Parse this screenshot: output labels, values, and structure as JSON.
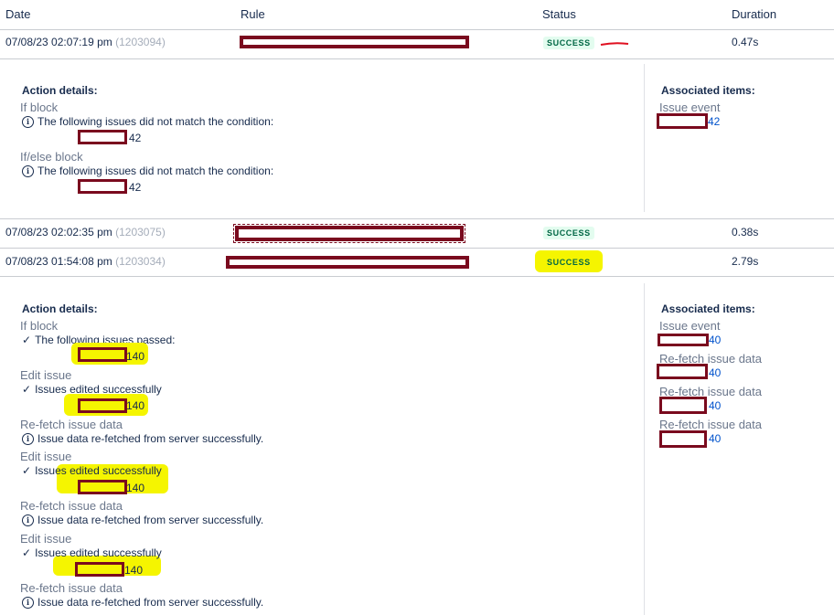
{
  "table": {
    "headers": {
      "date": "Date",
      "rule": "Rule",
      "status": "Status",
      "duration": "Duration"
    },
    "rows": [
      {
        "date": "07/08/23 02:07:19 pm",
        "id": "(1203094)",
        "status": "SUCCESS",
        "duration": "0.47s"
      },
      {
        "date": "07/08/23 02:02:35 pm",
        "id": "(1203075)",
        "status": "SUCCESS",
        "duration": "0.38s"
      },
      {
        "date": "07/08/23 01:54:08 pm",
        "id": "(1203034)",
        "status": "SUCCESS",
        "duration": "2.79s"
      }
    ]
  },
  "detail1": {
    "title": "Action details:",
    "blocks": [
      {
        "type": "If block",
        "icon": "info-icon",
        "message": "The following issues did not match the condition:",
        "num": "42"
      },
      {
        "type": "If/else block",
        "icon": "info-icon",
        "message": "The following issues did not match the condition:",
        "num": "42"
      }
    ],
    "assoc_title": "Associated items:",
    "assoc": [
      {
        "label": "Issue event",
        "num": "42"
      }
    ]
  },
  "detail2": {
    "title": "Action details:",
    "blocks": [
      {
        "type": "If block",
        "icon": "check-icon",
        "message": "The following issues passed:",
        "num": "140"
      },
      {
        "type": "Edit issue",
        "icon": "check-icon",
        "message": "Issues edited successfully",
        "num": "140"
      },
      {
        "type": "Re-fetch issue data",
        "icon": "info-icon",
        "message": "Issue data re-fetched from server successfully.",
        "num": ""
      },
      {
        "type": "Edit issue",
        "icon": "check-icon",
        "message": "Issues edited successfully",
        "num": "140"
      },
      {
        "type": "Re-fetch issue data",
        "icon": "info-icon",
        "message": "Issue data re-fetched from server successfully.",
        "num": ""
      },
      {
        "type": "Edit issue",
        "icon": "check-icon",
        "message": "Issues edited successfully",
        "num": "140"
      },
      {
        "type": "Re-fetch issue data",
        "icon": "info-icon",
        "message": "Issue data re-fetched from server successfully.",
        "num": ""
      }
    ],
    "assoc_title": "Associated items:",
    "assoc": [
      {
        "label": "Issue event",
        "num": "40"
      },
      {
        "label": "Re-fetch issue data",
        "num": "40"
      },
      {
        "label": "Re-fetch issue data",
        "num": "40"
      },
      {
        "label": "Re-fetch issue data",
        "num": "40"
      }
    ]
  },
  "colors": {
    "redaction": "#7a0a1e",
    "highlight": "#f5f500",
    "success_bg": "#e3fcef",
    "success_text": "#006644",
    "link": "#0052cc"
  }
}
